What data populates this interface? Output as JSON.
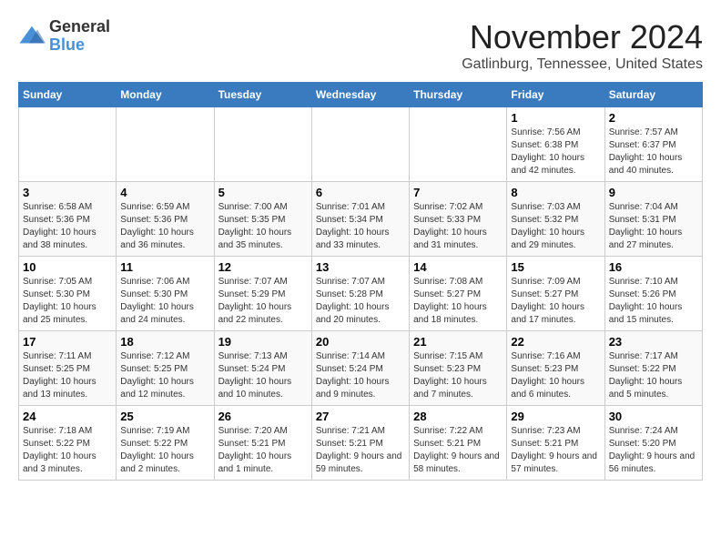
{
  "logo": {
    "general": "General",
    "blue": "Blue"
  },
  "header": {
    "month": "November 2024",
    "location": "Gatlinburg, Tennessee, United States"
  },
  "weekdays": [
    "Sunday",
    "Monday",
    "Tuesday",
    "Wednesday",
    "Thursday",
    "Friday",
    "Saturday"
  ],
  "weeks": [
    [
      {
        "day": "",
        "info": ""
      },
      {
        "day": "",
        "info": ""
      },
      {
        "day": "",
        "info": ""
      },
      {
        "day": "",
        "info": ""
      },
      {
        "day": "",
        "info": ""
      },
      {
        "day": "1",
        "info": "Sunrise: 7:56 AM\nSunset: 6:38 PM\nDaylight: 10 hours and 42 minutes."
      },
      {
        "day": "2",
        "info": "Sunrise: 7:57 AM\nSunset: 6:37 PM\nDaylight: 10 hours and 40 minutes."
      }
    ],
    [
      {
        "day": "3",
        "info": "Sunrise: 6:58 AM\nSunset: 5:36 PM\nDaylight: 10 hours and 38 minutes."
      },
      {
        "day": "4",
        "info": "Sunrise: 6:59 AM\nSunset: 5:36 PM\nDaylight: 10 hours and 36 minutes."
      },
      {
        "day": "5",
        "info": "Sunrise: 7:00 AM\nSunset: 5:35 PM\nDaylight: 10 hours and 35 minutes."
      },
      {
        "day": "6",
        "info": "Sunrise: 7:01 AM\nSunset: 5:34 PM\nDaylight: 10 hours and 33 minutes."
      },
      {
        "day": "7",
        "info": "Sunrise: 7:02 AM\nSunset: 5:33 PM\nDaylight: 10 hours and 31 minutes."
      },
      {
        "day": "8",
        "info": "Sunrise: 7:03 AM\nSunset: 5:32 PM\nDaylight: 10 hours and 29 minutes."
      },
      {
        "day": "9",
        "info": "Sunrise: 7:04 AM\nSunset: 5:31 PM\nDaylight: 10 hours and 27 minutes."
      }
    ],
    [
      {
        "day": "10",
        "info": "Sunrise: 7:05 AM\nSunset: 5:30 PM\nDaylight: 10 hours and 25 minutes."
      },
      {
        "day": "11",
        "info": "Sunrise: 7:06 AM\nSunset: 5:30 PM\nDaylight: 10 hours and 24 minutes."
      },
      {
        "day": "12",
        "info": "Sunrise: 7:07 AM\nSunset: 5:29 PM\nDaylight: 10 hours and 22 minutes."
      },
      {
        "day": "13",
        "info": "Sunrise: 7:07 AM\nSunset: 5:28 PM\nDaylight: 10 hours and 20 minutes."
      },
      {
        "day": "14",
        "info": "Sunrise: 7:08 AM\nSunset: 5:27 PM\nDaylight: 10 hours and 18 minutes."
      },
      {
        "day": "15",
        "info": "Sunrise: 7:09 AM\nSunset: 5:27 PM\nDaylight: 10 hours and 17 minutes."
      },
      {
        "day": "16",
        "info": "Sunrise: 7:10 AM\nSunset: 5:26 PM\nDaylight: 10 hours and 15 minutes."
      }
    ],
    [
      {
        "day": "17",
        "info": "Sunrise: 7:11 AM\nSunset: 5:25 PM\nDaylight: 10 hours and 13 minutes."
      },
      {
        "day": "18",
        "info": "Sunrise: 7:12 AM\nSunset: 5:25 PM\nDaylight: 10 hours and 12 minutes."
      },
      {
        "day": "19",
        "info": "Sunrise: 7:13 AM\nSunset: 5:24 PM\nDaylight: 10 hours and 10 minutes."
      },
      {
        "day": "20",
        "info": "Sunrise: 7:14 AM\nSunset: 5:24 PM\nDaylight: 10 hours and 9 minutes."
      },
      {
        "day": "21",
        "info": "Sunrise: 7:15 AM\nSunset: 5:23 PM\nDaylight: 10 hours and 7 minutes."
      },
      {
        "day": "22",
        "info": "Sunrise: 7:16 AM\nSunset: 5:23 PM\nDaylight: 10 hours and 6 minutes."
      },
      {
        "day": "23",
        "info": "Sunrise: 7:17 AM\nSunset: 5:22 PM\nDaylight: 10 hours and 5 minutes."
      }
    ],
    [
      {
        "day": "24",
        "info": "Sunrise: 7:18 AM\nSunset: 5:22 PM\nDaylight: 10 hours and 3 minutes."
      },
      {
        "day": "25",
        "info": "Sunrise: 7:19 AM\nSunset: 5:22 PM\nDaylight: 10 hours and 2 minutes."
      },
      {
        "day": "26",
        "info": "Sunrise: 7:20 AM\nSunset: 5:21 PM\nDaylight: 10 hours and 1 minute."
      },
      {
        "day": "27",
        "info": "Sunrise: 7:21 AM\nSunset: 5:21 PM\nDaylight: 9 hours and 59 minutes."
      },
      {
        "day": "28",
        "info": "Sunrise: 7:22 AM\nSunset: 5:21 PM\nDaylight: 9 hours and 58 minutes."
      },
      {
        "day": "29",
        "info": "Sunrise: 7:23 AM\nSunset: 5:21 PM\nDaylight: 9 hours and 57 minutes."
      },
      {
        "day": "30",
        "info": "Sunrise: 7:24 AM\nSunset: 5:20 PM\nDaylight: 9 hours and 56 minutes."
      }
    ]
  ]
}
